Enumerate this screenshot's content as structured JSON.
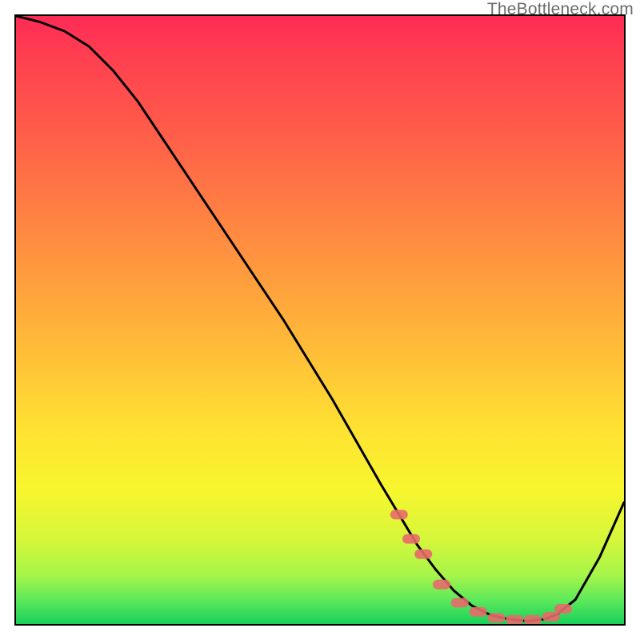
{
  "watermark": "TheBottleneck.com",
  "chart_data": {
    "type": "line",
    "title": "",
    "xlabel": "",
    "ylabel": "",
    "xlim": [
      0,
      100
    ],
    "ylim": [
      0,
      100
    ],
    "grid": false,
    "legend": false,
    "series": [
      {
        "name": "curve",
        "color": "#000000",
        "x": [
          0,
          4,
          8,
          12,
          16,
          20,
          24,
          28,
          32,
          36,
          40,
          44,
          48,
          52,
          56,
          60,
          63,
          66,
          69,
          72,
          75,
          78,
          81,
          84,
          87,
          89,
          92,
          96,
          100
        ],
        "y": [
          100,
          99,
          97.5,
          95,
          91,
          86,
          80,
          74,
          68,
          62,
          56,
          50,
          43.5,
          37,
          30,
          23,
          18,
          13,
          9,
          5.5,
          3,
          1.5,
          0.8,
          0.5,
          0.8,
          1.6,
          4,
          11,
          20
        ]
      },
      {
        "name": "trough-markers",
        "color": "#e76a6a",
        "type": "scatter",
        "x": [
          63,
          65,
          67,
          70,
          73,
          76,
          79,
          82,
          85,
          88,
          90
        ],
        "y": [
          18,
          14,
          11.5,
          6.5,
          3.5,
          2,
          1,
          0.7,
          0.7,
          1.2,
          2.5
        ]
      }
    ],
    "background_gradient": {
      "direction": "vertical",
      "stops": [
        {
          "pos": 0.0,
          "color": "#ff2a55"
        },
        {
          "pos": 0.3,
          "color": "#ff7a44"
        },
        {
          "pos": 0.55,
          "color": "#ffbd38"
        },
        {
          "pos": 0.78,
          "color": "#f7f62e"
        },
        {
          "pos": 0.92,
          "color": "#a6f54a"
        },
        {
          "pos": 1.0,
          "color": "#18d15a"
        }
      ]
    }
  }
}
